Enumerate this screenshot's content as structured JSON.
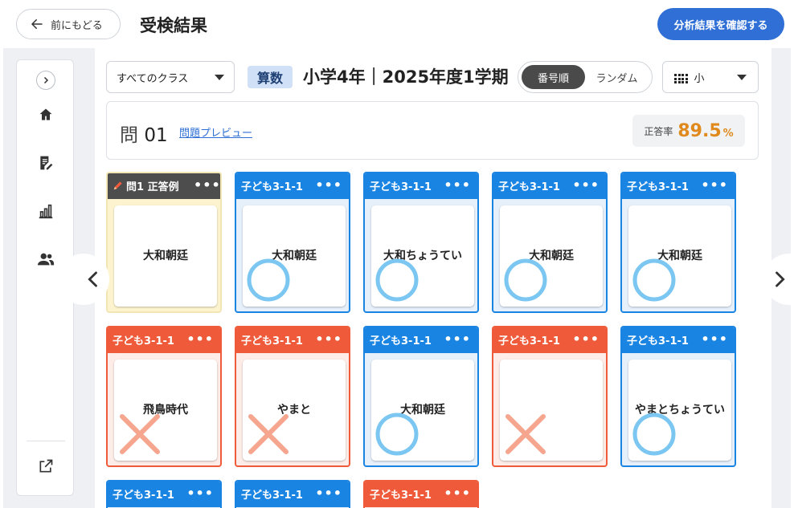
{
  "header": {
    "back_label": "前にもどる",
    "title": "受検結果",
    "analysis_label": "分析結果を確認する"
  },
  "filters": {
    "class_select": "すべてのクラス",
    "subject": "算数",
    "test_title": "小学4年｜2025年度1学期",
    "order_options": [
      "番号順",
      "ランダム"
    ],
    "order_active": "番号順",
    "size_select": "小"
  },
  "question": {
    "label_prefix": "問",
    "number": "01",
    "preview_label": "問題プレビュー",
    "rate_label": "正答率",
    "rate_value": "89.5",
    "rate_unit": "%"
  },
  "cards": [
    {
      "header": "問1 正答例",
      "answer": "大和朝廷",
      "status": "key"
    },
    {
      "header": "子ども3-1-1",
      "answer": "大和朝廷",
      "status": "correct"
    },
    {
      "header": "子ども3-1-1",
      "answer": "大和ちょうてい",
      "status": "correct"
    },
    {
      "header": "子ども3-1-1",
      "answer": "大和朝廷",
      "status": "correct"
    },
    {
      "header": "子ども3-1-1",
      "answer": "大和朝廷",
      "status": "correct"
    },
    {
      "header": "子ども3-1-1",
      "answer": "飛鳥時代",
      "status": "incorrect"
    },
    {
      "header": "子ども3-1-1",
      "answer": "やまと",
      "status": "incorrect"
    },
    {
      "header": "子ども3-1-1",
      "answer": "大和朝廷",
      "status": "correct"
    },
    {
      "header": "子ども3-1-1",
      "answer": "",
      "status": "incorrect"
    },
    {
      "header": "子ども3-1-1",
      "answer": "やまとちょうてい",
      "status": "correct"
    },
    {
      "header": "子ども3-1-1",
      "answer": "",
      "status": "correct"
    },
    {
      "header": "子ども3-1-1",
      "answer": "",
      "status": "correct"
    },
    {
      "header": "子ども3-1-1",
      "answer": "",
      "status": "incorrect"
    }
  ],
  "colors": {
    "correct": "#1a84e3",
    "incorrect": "#ef5a3a",
    "primary": "#2f6fd6",
    "accent_rate": "#e08a1e"
  },
  "icons": [
    "arrow-left-icon",
    "chevron-right-icon",
    "home-icon",
    "edit-document-icon",
    "bar-chart-icon",
    "people-icon",
    "external-link-icon",
    "more-dots-icon",
    "pencil-icon",
    "grid-icon",
    "caret-down-icon",
    "circle-mark-icon",
    "cross-mark-icon",
    "chevron-left-icon"
  ]
}
